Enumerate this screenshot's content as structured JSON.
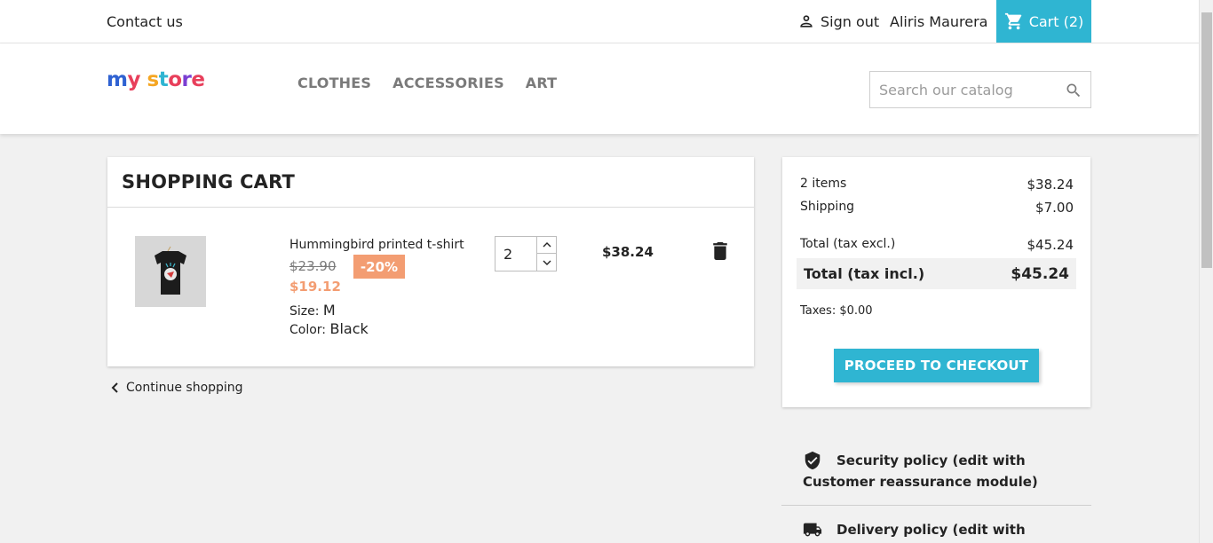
{
  "topbar": {
    "contact_label": "Contact us",
    "signout_label": "Sign out",
    "username": "Aliris Maurera",
    "cart_label": "Cart (2)"
  },
  "header": {
    "logo_text": "my store",
    "nav": [
      "CLOTHES",
      "ACCESSORIES",
      "ART"
    ],
    "search_placeholder": "Search our catalog"
  },
  "cart": {
    "title": "SHOPPING CART",
    "item": {
      "name": "Hummingbird printed t-shirt",
      "old_price": "$23.90",
      "discount": "-20%",
      "price": "$19.12",
      "size_label": "Size:",
      "size_value": "M",
      "color_label": "Color:",
      "color_value": "Black",
      "quantity": "2",
      "line_total": "$38.24"
    },
    "continue_label": "Continue shopping"
  },
  "summary": {
    "items_label": "2 items",
    "items_value": "$38.24",
    "shipping_label": "Shipping",
    "shipping_value": "$7.00",
    "total_excl_label": "Total (tax excl.)",
    "total_excl_value": "$45.24",
    "total_incl_label": "Total (tax incl.)",
    "total_incl_value": "$45.24",
    "taxes_label": "Taxes: $0.00",
    "checkout_label": "PROCEED TO CHECKOUT"
  },
  "reassurance": {
    "security": [
      "Security policy (edit with",
      "Customer reassurance module)"
    ],
    "delivery": [
      "Delivery policy (edit with"
    ]
  },
  "colors": {
    "accent": "#2fb5d2",
    "discount": "#f39d72"
  }
}
